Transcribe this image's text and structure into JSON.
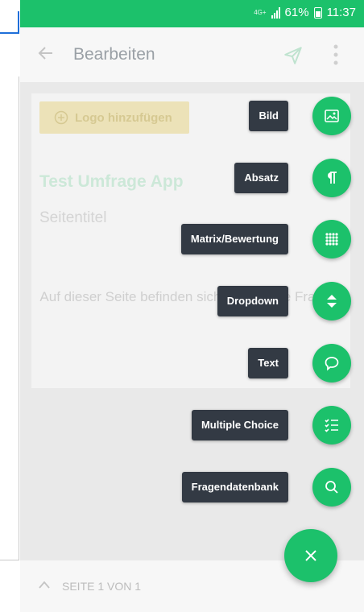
{
  "status_bar": {
    "network": "4G+",
    "battery": "61%",
    "time": "11:37"
  },
  "app_bar": {
    "title": "Bearbeiten"
  },
  "card": {
    "logo_button": "Logo hinzufügen",
    "survey_title": "Test Umfrage App",
    "page_title": "Seitentitel",
    "empty_message": "Auf dieser Seite befinden sich noch keine Fragen."
  },
  "footer": {
    "page_indicator": "SEITE 1 VON 1"
  },
  "fab_menu": {
    "items": [
      {
        "label": "Bild",
        "icon": "image-icon"
      },
      {
        "label": "Absatz",
        "icon": "pilcrow-icon"
      },
      {
        "label": "Matrix/Bewertung",
        "icon": "grid-icon"
      },
      {
        "label": "Dropdown",
        "icon": "dropdown-icon"
      },
      {
        "label": "Text",
        "icon": "speech-bubble-icon"
      },
      {
        "label": "Multiple Choice",
        "icon": "checklist-icon"
      },
      {
        "label": "Fragendatenbank",
        "icon": "search-icon"
      }
    ],
    "close_icon": "close-icon"
  },
  "colors": {
    "accent": "#1cc16b",
    "label_bg": "#333a44",
    "scrim": "#e9e9e9"
  }
}
